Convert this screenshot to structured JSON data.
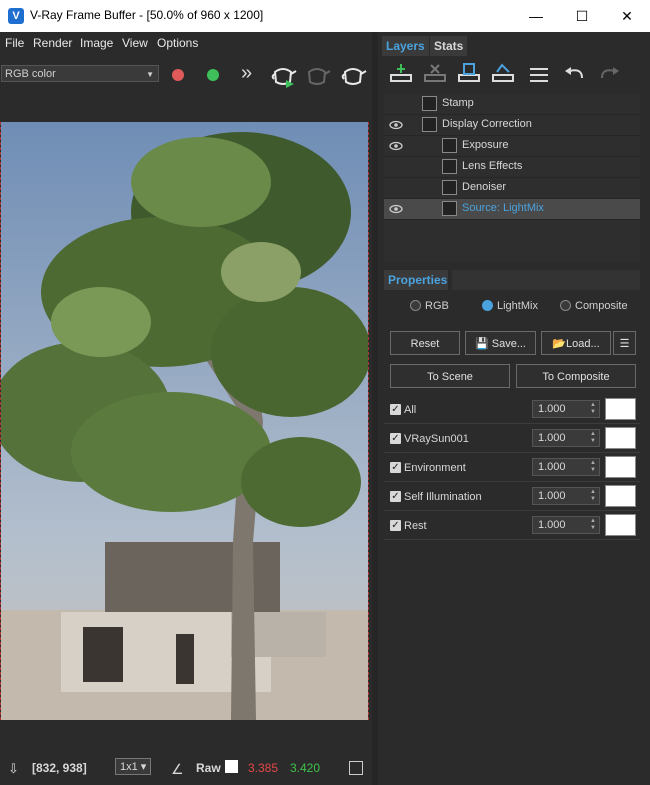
{
  "window": {
    "title": "V-Ray Frame Buffer - [50.0% of 960 x 1200]",
    "minimize": "—",
    "maximize": "☐",
    "close": "✕"
  },
  "menu": [
    "File",
    "Render",
    "Image",
    "View",
    "Options"
  ],
  "toolbar": {
    "channel": "RGB color",
    "more": "»"
  },
  "status": {
    "coords": "[832, 938]",
    "sample": "1x1",
    "raw": "Raw",
    "val1": "3.385",
    "val2": "3.420"
  },
  "tabs": [
    "Layers",
    "Stats"
  ],
  "layers": [
    {
      "name": "Stamp",
      "visible": false,
      "indent": false,
      "selected": false
    },
    {
      "name": "Display Correction",
      "visible": true,
      "indent": false,
      "selected": false
    },
    {
      "name": "Exposure",
      "visible": true,
      "indent": true,
      "selected": false
    },
    {
      "name": "Lens Effects",
      "visible": false,
      "indent": true,
      "selected": false
    },
    {
      "name": "Denoiser",
      "visible": false,
      "indent": true,
      "selected": false
    },
    {
      "name": "Source: LightMix",
      "visible": true,
      "indent": true,
      "selected": true
    }
  ],
  "properties": {
    "title": "Properties",
    "modes": [
      "RGB",
      "LightMix",
      "Composite"
    ],
    "selected_mode": "LightMix",
    "reset": "Reset",
    "save": "Save...",
    "load": "Load...",
    "to_scene": "To Scene",
    "to_composite": "To Composite"
  },
  "lightmix": [
    {
      "name": "All",
      "value": "1.000",
      "color": "#ffffff"
    },
    {
      "name": "VRaySun001",
      "value": "1.000",
      "color": "#ffffff"
    },
    {
      "name": "Environment",
      "value": "1.000",
      "color": "#ffffff"
    },
    {
      "name": "Self Illumination",
      "value": "1.000",
      "color": "#ffffff"
    },
    {
      "name": "Rest",
      "value": "1.000",
      "color": "#ffffff"
    }
  ],
  "colors": {
    "accent": "#4aa3df",
    "red_dot": "#e05a5a",
    "green_dot": "#3fbf5a",
    "val_red": "#e04848",
    "val_green": "#3fc14a"
  }
}
